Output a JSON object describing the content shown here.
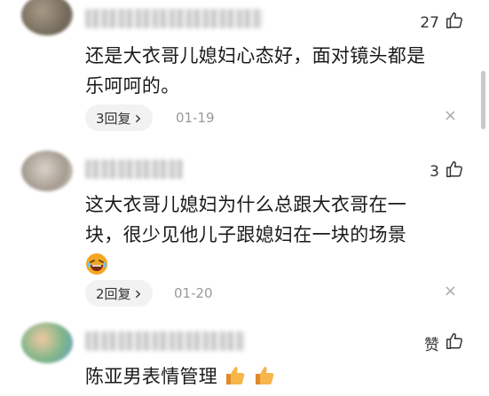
{
  "comments": [
    {
      "likes": "27",
      "text_line1": "还是大衣哥儿媳妇心态好，面对镜头都是",
      "text_line2": "乐呵呵的。",
      "reply_label": "3回复",
      "date": "01-19"
    },
    {
      "likes": "3",
      "text_line1": "这大衣哥儿媳妇为什么总跟大衣哥在一",
      "text_line2": "块，很少见他儿子跟媳妇在一块的场景",
      "emoji": "laughing-crying-emoji",
      "reply_label": "2回复",
      "date": "01-20"
    },
    {
      "likes": "赞",
      "text_line1": "陈亚男表情管理",
      "emoji": "thumbs-up-emoji"
    }
  ],
  "icons": {
    "like": "thumbs-up-outline-icon",
    "chevron": "chevron-right-icon",
    "close": "close-icon"
  },
  "close_glyph": "×",
  "chevron_glyph": "›",
  "colors": {
    "text": "#1a1a1a",
    "muted": "#999999",
    "pill_bg": "#f2f2f2",
    "emoji": "#f5a623"
  }
}
